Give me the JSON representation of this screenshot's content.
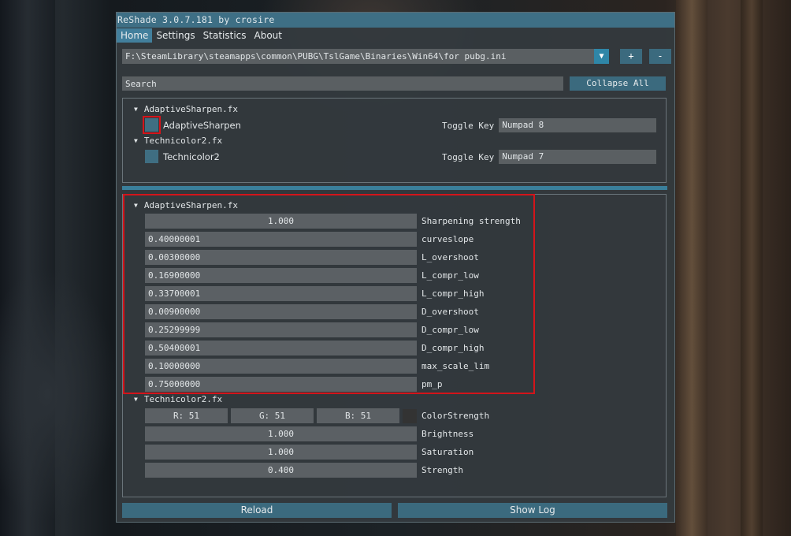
{
  "window": {
    "title": "ReShade 3.0.7.181 by crosire"
  },
  "menu": [
    "Home",
    "Settings",
    "Statistics",
    "About"
  ],
  "preset": {
    "path": "F:\\SteamLibrary\\steamapps\\common\\PUBG\\TslGame\\Binaries\\Win64\\for pubg.ini",
    "arrow": "▼",
    "add_label": "+",
    "remove_label": "-"
  },
  "search": {
    "placeholder": "Search",
    "collapse_label": "Collapse All"
  },
  "techniques": [
    {
      "file": "AdaptiveSharpen.fx",
      "name": "AdaptiveSharpen",
      "toggle_label": "Toggle Key",
      "toggle_key": "Numpad 8"
    },
    {
      "file": "Technicolor2.fx",
      "name": "Technicolor2",
      "toggle_label": "Toggle Key",
      "toggle_key": "Numpad 7"
    }
  ],
  "params": {
    "adaptive": {
      "file": "AdaptiveSharpen.fx",
      "items": [
        {
          "value": "1.000",
          "label": "Sharpening strength"
        },
        {
          "value": "0.40000001",
          "label": "curveslope"
        },
        {
          "value": "0.00300000",
          "label": "L_overshoot"
        },
        {
          "value": "0.16900000",
          "label": "L_compr_low"
        },
        {
          "value": "0.33700001",
          "label": "L_compr_high"
        },
        {
          "value": "0.00900000",
          "label": "D_overshoot"
        },
        {
          "value": "0.25299999",
          "label": "D_compr_low"
        },
        {
          "value": "0.50400001",
          "label": "D_compr_high"
        },
        {
          "value": "0.10000000",
          "label": "max_scale_lim"
        },
        {
          "value": "0.75000000",
          "label": "pm_p"
        }
      ]
    },
    "technicolor": {
      "file": "Technicolor2.fx",
      "color": {
        "r": "R: 51",
        "g": "G: 51",
        "b": "B: 51",
        "label": "ColorStrength",
        "swatch": "#333333"
      },
      "items": [
        {
          "value": "1.000",
          "label": "Brightness"
        },
        {
          "value": "1.000",
          "label": "Saturation"
        },
        {
          "value": "0.400",
          "label": "Strength"
        }
      ]
    }
  },
  "footer": {
    "reload_label": "Reload",
    "showlog_label": "Show Log"
  },
  "colors": {
    "accent": "#3e6f85",
    "highlight": "#d4141a"
  }
}
